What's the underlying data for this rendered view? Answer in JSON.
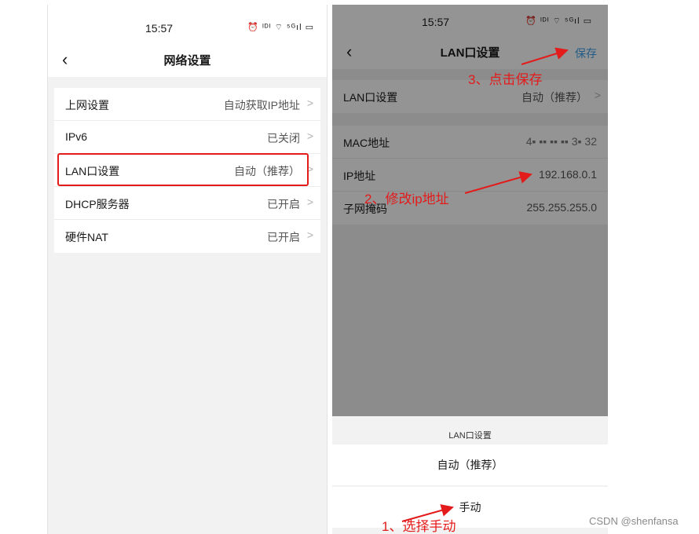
{
  "status": {
    "time": "15:57",
    "icons_text": "⏰ ᴵᴰᴵ ⌔ ⁵ᴳıl ▭"
  },
  "left": {
    "title": "网络设置",
    "rows": [
      {
        "label": "上网设置",
        "value": "自动获取IP地址"
      },
      {
        "label": "IPv6",
        "value": "已关闭"
      },
      {
        "label": "LAN口设置",
        "value": "自动（推荐）"
      },
      {
        "label": "DHCP服务器",
        "value": "已开启"
      },
      {
        "label": "硬件NAT",
        "value": "已开启"
      }
    ]
  },
  "right": {
    "title": "LAN口设置",
    "save_label": "保存",
    "mode": {
      "label": "LAN口设置",
      "value": "自动（推荐）"
    },
    "info": [
      {
        "label": "MAC地址",
        "value": "4▪ ▪▪ ▪▪ ▪▪ 3▪ 32"
      },
      {
        "label": "IP地址",
        "value": "192.168.0.1"
      },
      {
        "label": "子网掩码",
        "value": "255.255.255.0"
      }
    ],
    "sheet": {
      "title": "LAN口设置",
      "option_auto": "自动（推荐）",
      "option_manual": "手动"
    }
  },
  "annotations": {
    "step1": "1、选择手动",
    "step2": "2、修改ip地址",
    "step3": "3、点击保存"
  },
  "watermark": "CSDN @shenfansa",
  "colors": {
    "annotation": "#e31b1b",
    "save_link": "#3aa0e8"
  }
}
